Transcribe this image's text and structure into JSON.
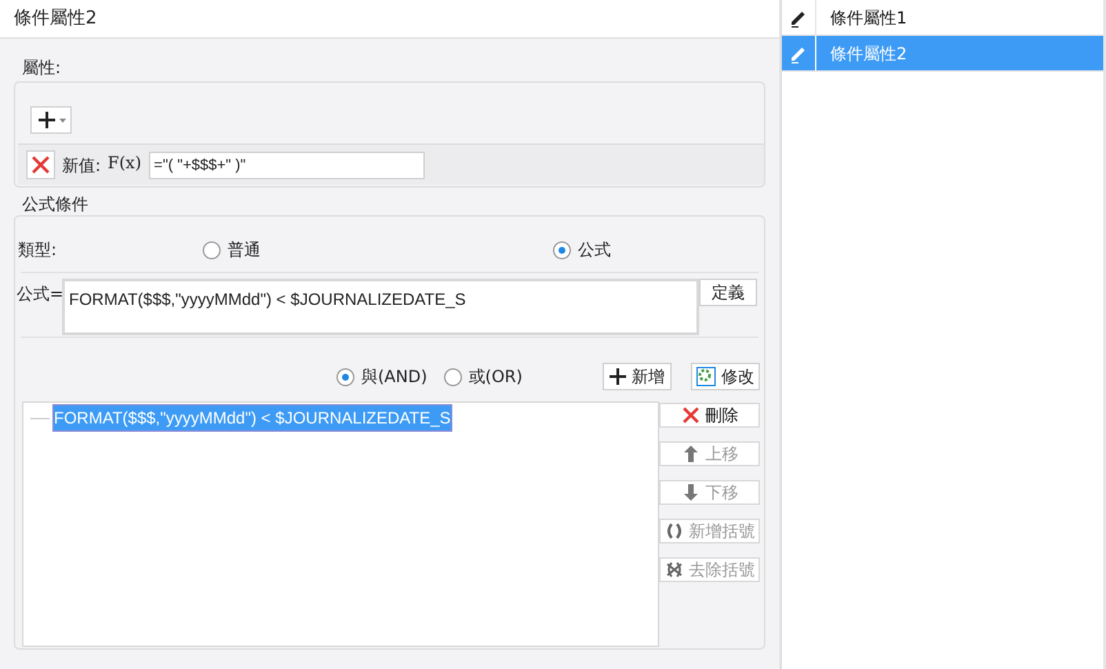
{
  "title": "條件屬性2",
  "attribute_group": {
    "legend": "屬性:",
    "new_value_label": "新值:",
    "fx_label": "F(x)",
    "new_value": "=\"( \"+$$$+\" )\""
  },
  "formula_group": {
    "legend": "公式條件",
    "type_label": "類型:",
    "type_options": [
      {
        "label": "普通",
        "selected": false
      },
      {
        "label": "公式",
        "selected": true
      }
    ],
    "formula_label": "公式=",
    "formula": "FORMAT($$$,\"yyyyMMdd\") < $JOURNALIZEDATE_S",
    "define_button": "定義",
    "logic_options": [
      {
        "label": "與(AND)",
        "selected": true
      },
      {
        "label": "或(OR)",
        "selected": false
      }
    ],
    "add_button": "新增",
    "modify_button": "修改",
    "conditions": [
      {
        "text": "FORMAT($$$,\"yyyyMMdd\") < $JOURNALIZEDATE_S",
        "selected": true
      }
    ],
    "side_buttons": [
      {
        "kind": "delete",
        "label": "刪除",
        "disabled": false
      },
      {
        "kind": "up",
        "label": "上移",
        "disabled": true
      },
      {
        "kind": "down",
        "label": "下移",
        "disabled": true
      },
      {
        "kind": "add-bracket",
        "label": "新增括號",
        "disabled": true
      },
      {
        "kind": "remove-bracket",
        "label": "去除括號",
        "disabled": true
      }
    ]
  },
  "attribute_list": [
    {
      "label": "條件屬性1",
      "selected": false
    },
    {
      "label": "條件屬性2",
      "selected": true
    }
  ]
}
